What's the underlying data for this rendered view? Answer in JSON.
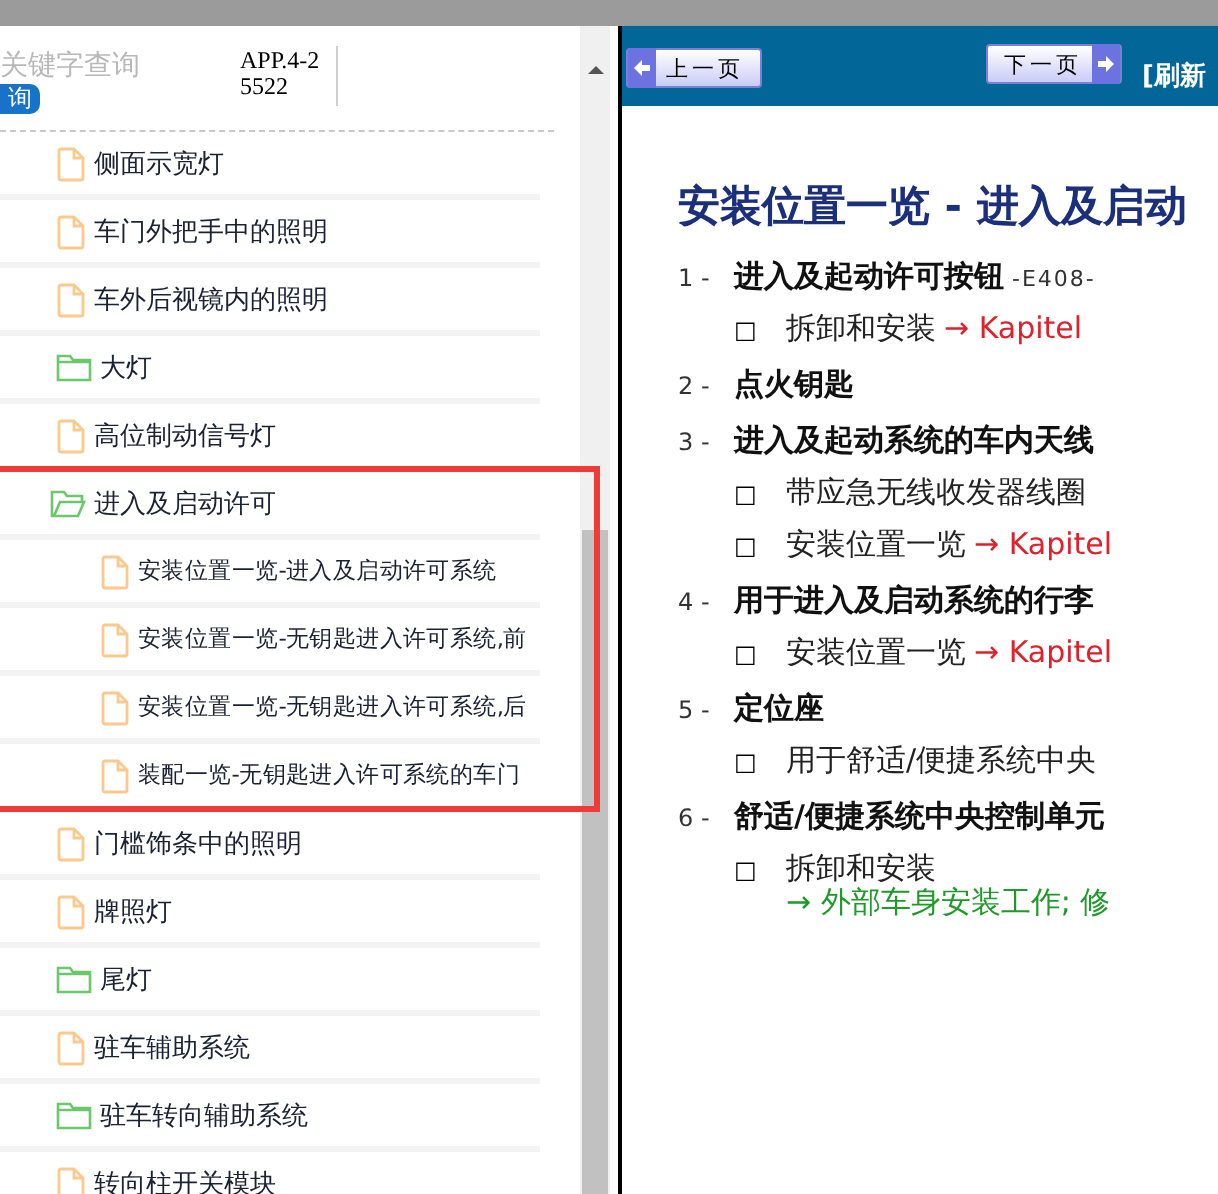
{
  "search": {
    "placeholder": "关键字查询",
    "button": "询"
  },
  "app_code": "APP.4-25522",
  "tree": [
    {
      "kind": "document",
      "label": "侧面示宽灯"
    },
    {
      "kind": "document",
      "label": "车门外把手中的照明"
    },
    {
      "kind": "document",
      "label": "车外后视镜内的照明"
    },
    {
      "kind": "folder",
      "label": "大灯",
      "expanded": false
    },
    {
      "kind": "document",
      "label": "高位制动信号灯"
    },
    {
      "kind": "folder",
      "label": "进入及启动许可",
      "expanded": true,
      "highlighted": true,
      "children": [
        {
          "kind": "document",
          "label": "安装位置一览-进入及启动许可系统"
        },
        {
          "kind": "document",
          "label": "安装位置一览-无钥匙进入许可系统,前"
        },
        {
          "kind": "document",
          "label": "安装位置一览-无钥匙进入许可系统,后"
        },
        {
          "kind": "document",
          "label": "装配一览-无钥匙进入许可系统的车门"
        }
      ]
    },
    {
      "kind": "document",
      "label": "门槛饰条中的照明"
    },
    {
      "kind": "document",
      "label": "牌照灯"
    },
    {
      "kind": "folder",
      "label": "尾灯",
      "expanded": false
    },
    {
      "kind": "document",
      "label": "驻车辅助系统"
    },
    {
      "kind": "folder",
      "label": "驻车转向辅助系统",
      "expanded": false
    },
    {
      "kind": "document",
      "label": "转向柱开关模块"
    }
  ],
  "toolbar": {
    "prev": "上一页",
    "next": "下一页",
    "refresh": "[刷新"
  },
  "document": {
    "title": "安装位置一览 - 进入及启动",
    "items": [
      {
        "marker": "1 -",
        "title": "进入及起动许可按钮",
        "code": "-E408-",
        "subitems": [
          {
            "bullet": "□",
            "text": "拆卸和安装",
            "link": "→ Kapitel",
            "kind": "inline"
          }
        ]
      },
      {
        "marker": "2 -",
        "title": "点火钥匙"
      },
      {
        "marker": "3 -",
        "title": "进入及起动系统的车内天线",
        "subitems": [
          {
            "bullet": "□",
            "text": "带应急无线收发器线圈"
          },
          {
            "bullet": "□",
            "text": "安装位置一览",
            "link": "→ Kapitel",
            "kind": "inline"
          }
        ]
      },
      {
        "marker": "4 -",
        "title": "用于进入及启动系统的行李",
        "subitems": [
          {
            "bullet": "□",
            "text": "安装位置一览",
            "link": "→ Kapitel",
            "kind": "inline"
          }
        ]
      },
      {
        "marker": "5 -",
        "title": "定位座",
        "subitems": [
          {
            "bullet": "□",
            "text": "用于舒适/便捷系统中央"
          }
        ]
      },
      {
        "marker": "6 -",
        "title": "舒适/便捷系统中央控制单元",
        "subitems": [
          {
            "bullet": "□",
            "text": "拆卸和安装",
            "link": "→ 外部车身安装工作; 修",
            "kind": "block"
          }
        ]
      }
    ]
  }
}
